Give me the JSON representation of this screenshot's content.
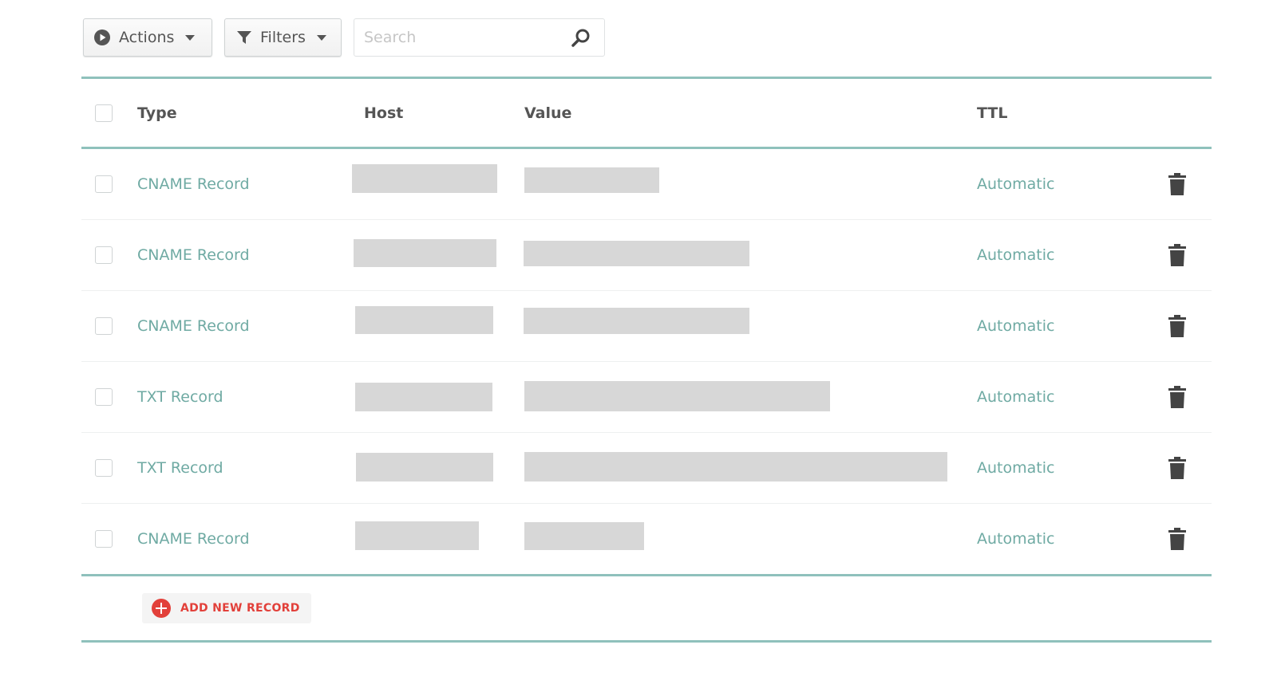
{
  "toolbar": {
    "actions_label": "Actions",
    "filters_label": "Filters",
    "search_placeholder": "Search"
  },
  "table": {
    "columns": [
      "Type",
      "Host",
      "Value",
      "TTL"
    ],
    "rows": [
      {
        "type": "CNAME Record",
        "ttl": "Automatic"
      },
      {
        "type": "CNAME Record",
        "ttl": "Automatic"
      },
      {
        "type": "CNAME Record",
        "ttl": "Automatic"
      },
      {
        "type": "TXT Record",
        "ttl": "Automatic"
      },
      {
        "type": "TXT Record",
        "ttl": "Automatic"
      },
      {
        "type": "CNAME Record",
        "ttl": "Automatic"
      }
    ],
    "add_label": "ADD NEW RECORD"
  },
  "colors": {
    "accent": "#8fc1bc",
    "link_teal": "#6faaa3",
    "add_red": "#e2403a",
    "redaction": "#d7d7d7"
  },
  "icons": {
    "actions": "play-circle-icon",
    "filters": "funnel-icon",
    "search": "search-icon",
    "dropdown": "caret-down-icon",
    "delete": "trash-icon",
    "add": "plus-circle-icon"
  }
}
